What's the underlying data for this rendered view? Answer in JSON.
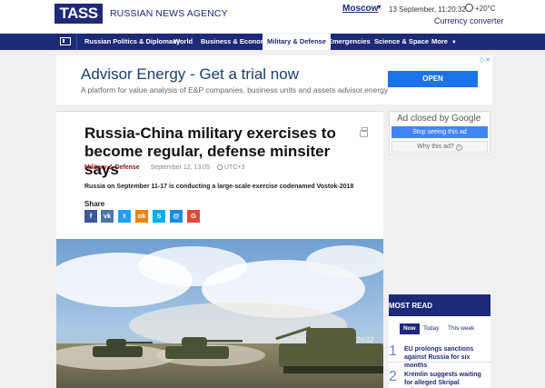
{
  "header": {
    "logo": "TASS",
    "agency": "RUSSIAN NEWS AGENCY",
    "city": "Moscow",
    "datetime": "13 September, 11:20:32",
    "temperature": "+20°C",
    "currency_link": "Currency converter"
  },
  "nav": {
    "items": [
      {
        "label": "Russian Politics & Diplomacy"
      },
      {
        "label": "World"
      },
      {
        "label": "Business & Economy"
      },
      {
        "label": "Military & Defense",
        "active": true
      },
      {
        "label": "Emergencies"
      },
      {
        "label": "Science & Space"
      },
      {
        "label": "More"
      }
    ]
  },
  "banner_ad": {
    "title": "Advisor Energy - Get a trial now",
    "subtitle": "A platform for value analysis of E&P companies, business units and assets advisor.energy",
    "button": "OPEN"
  },
  "article": {
    "headline": "Russia-China military exercises to become regular, defense minsiter says",
    "category": "Military & Defense",
    "date": "September 12, 13:05",
    "timezone": "UTC+3",
    "lead": "Russia on September 11-17 is conducting a large-scale exercise codenamed Vostok-2018",
    "share_label": "Share",
    "share_buttons": [
      {
        "icon": "facebook-icon",
        "glyph": "f",
        "color": "#3b5998"
      },
      {
        "icon": "vk-icon",
        "glyph": "vk",
        "color": "#4a76a8"
      },
      {
        "icon": "twitter-icon",
        "glyph": "t",
        "color": "#1da1f2"
      },
      {
        "icon": "odnoklassniki-icon",
        "glyph": "ok",
        "color": "#ee8208"
      },
      {
        "icon": "skype-icon",
        "glyph": "S",
        "color": "#00aff0"
      },
      {
        "icon": "email-icon",
        "glyph": "@",
        "color": "#168de2"
      },
      {
        "icon": "google-plus-icon",
        "glyph": "G",
        "color": "#dd4b39"
      }
    ],
    "photo_label": "2032"
  },
  "side_ad": {
    "title": "Ad closed by Google",
    "stop_button": "Stop seeing this ad",
    "why_button": "Why this ad?"
  },
  "most_read": {
    "heading": "MOST READ",
    "tabs": [
      "Now",
      "Today",
      "This week"
    ],
    "items": [
      {
        "num": "1",
        "text": "EU prolongs sanctions against Russia for six months"
      },
      {
        "num": "2",
        "text": "Kremlin suggests waiting for alleged Skripal poisoning"
      }
    ]
  },
  "colors": {
    "brand": "#1d2a78",
    "accent": "#8b1414",
    "ad_button": "#1a73e8"
  }
}
